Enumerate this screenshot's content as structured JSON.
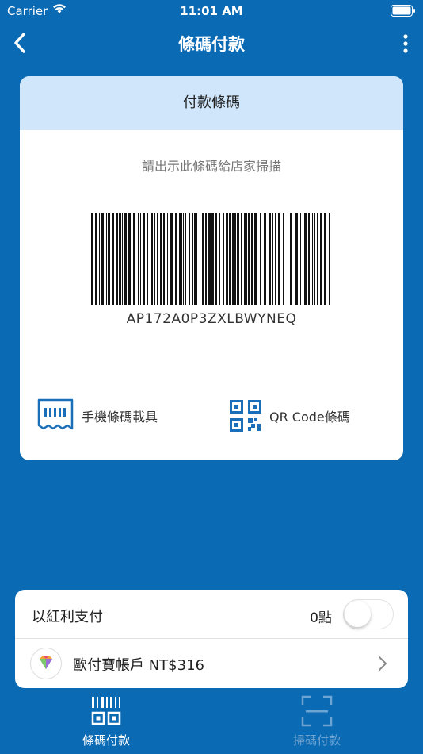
{
  "status_bar": {
    "carrier": "Carrier",
    "time": "11:01 AM"
  },
  "nav": {
    "title": "條碼付款",
    "back_icon": "chevron-left-icon",
    "more_icon": "more-vertical-icon"
  },
  "card": {
    "header": "付款條碼",
    "hint": "請出示此條碼給店家掃描",
    "barcode_value": "AP172A0P3ZXLBWYNEQ",
    "options": [
      {
        "label": "手機條碼載具",
        "icon": "receipt-barcode-icon"
      },
      {
        "label": "QR Code條碼",
        "icon": "qr-code-icon"
      }
    ]
  },
  "sheet": {
    "bonus_label": "以紅利支付",
    "bonus_points": "0點",
    "bonus_toggle_on": false,
    "account_label": "歐付寶帳戶 NT$316"
  },
  "tabs": [
    {
      "label": "條碼付款",
      "active": true
    },
    {
      "label": "掃碼付款",
      "active": false
    }
  ],
  "colors": {
    "brand": "#0a6ab4",
    "header_bg": "#cfe6fb",
    "icon_blue": "#1a6fb8"
  }
}
